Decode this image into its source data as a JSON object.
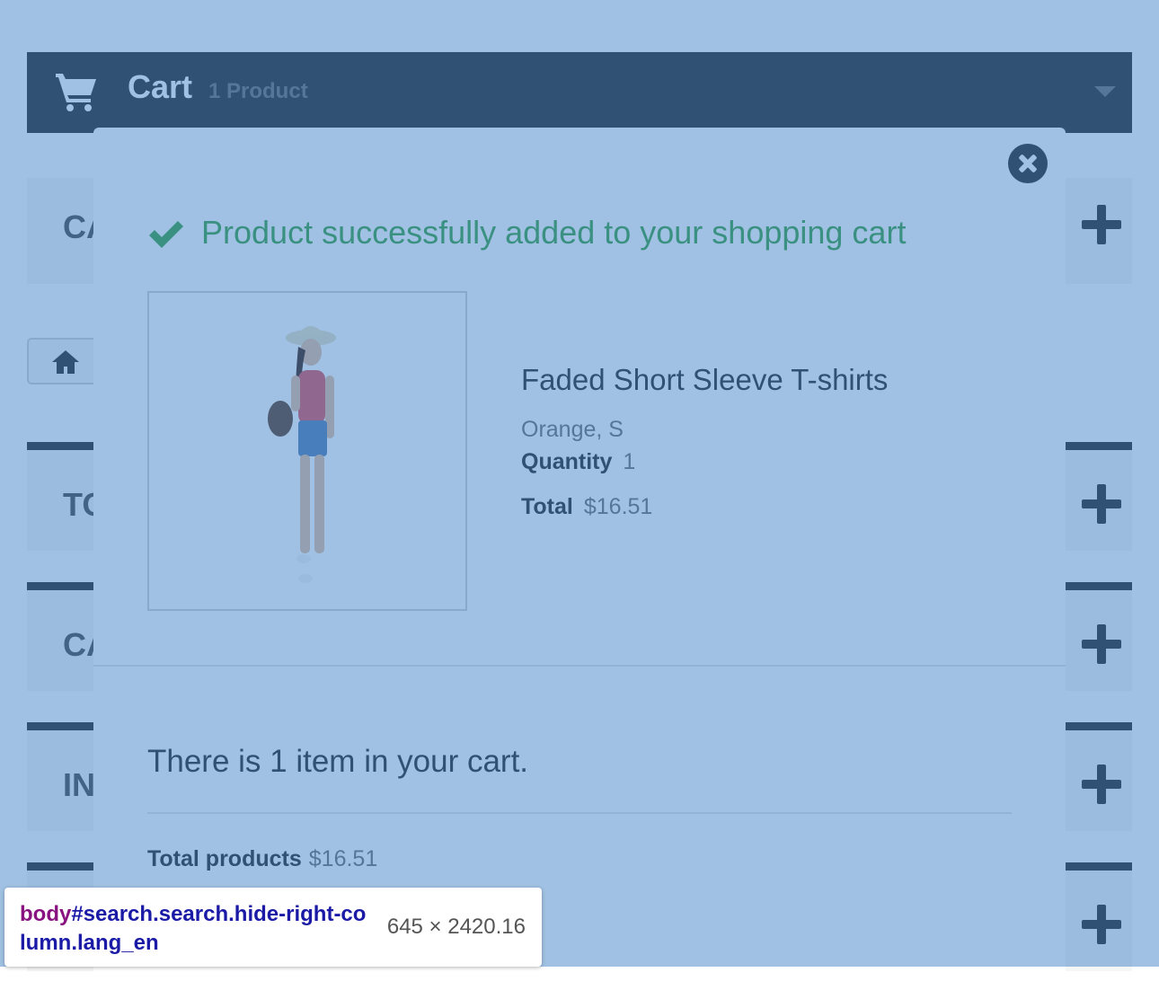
{
  "cart": {
    "title": "Cart",
    "count": "1 Product"
  },
  "blocks": [
    {
      "title": "CA"
    },
    {
      "title": "TO"
    },
    {
      "title": "CA"
    },
    {
      "title": "IN"
    },
    {
      "title": ""
    }
  ],
  "modal": {
    "success_message": "Product successfully added to your shopping cart",
    "product": {
      "name": "Faded Short Sleeve T-shirts",
      "attributes": "Orange, S",
      "quantity_label": "Quantity",
      "quantity_value": "1",
      "total_label": "Total",
      "total_value": "$16.51"
    },
    "cart_summary": "There is 1 item in your cart.",
    "total_products_label": "Total products",
    "total_products_value": "$16.51"
  },
  "tooltip": {
    "tag": "body",
    "selector": "#search.search.hide-right-column.lang_en",
    "dimensions": "645 × 2420.16"
  },
  "colors": {
    "overlay": "#2c76c1",
    "success": "#46a74e",
    "dark": "#333333"
  },
  "icons": [
    "cart-icon",
    "chevron-down-icon",
    "plus-icon",
    "home-icon",
    "close-icon",
    "checkmark-icon"
  ]
}
